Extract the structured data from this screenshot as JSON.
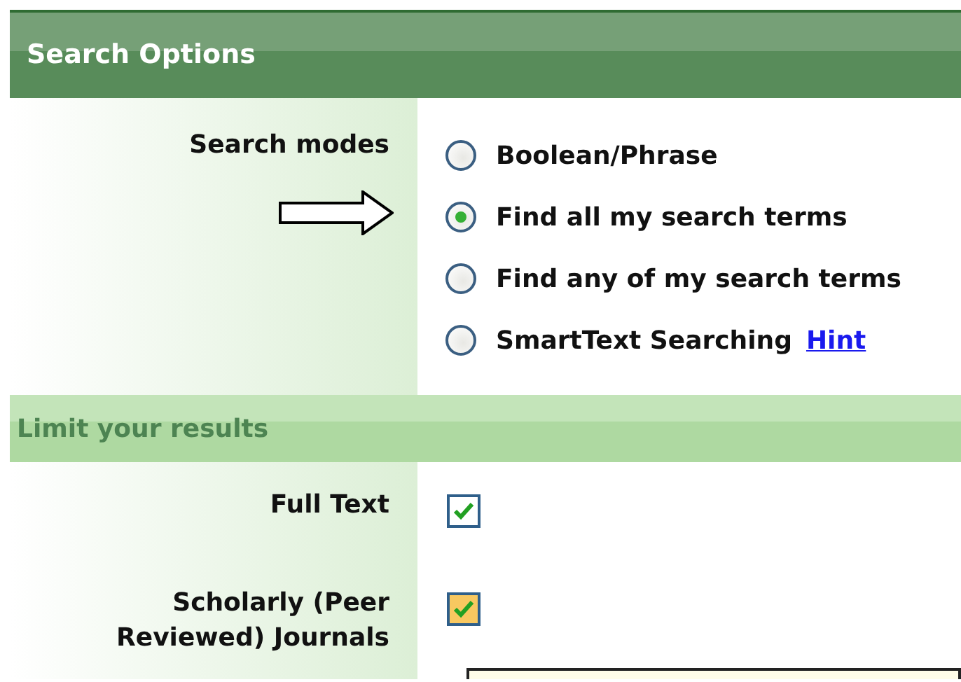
{
  "search_options": {
    "title": "Search Options",
    "search_modes": {
      "label": "Search modes",
      "options": [
        {
          "label": "Boolean/Phrase",
          "selected": false
        },
        {
          "label": "Find all my search terms",
          "selected": true
        },
        {
          "label": "Find any of my search terms",
          "selected": false
        },
        {
          "label": "SmartText Searching",
          "selected": false,
          "link": "Hint"
        }
      ]
    }
  },
  "limit_results": {
    "title": "Limit your results",
    "rows": [
      {
        "label": "Full Text",
        "checked": true,
        "color": "#ffffff"
      },
      {
        "label": "Scholarly (Peer Reviewed) Journals",
        "checked": true,
        "color": "#f8c860"
      }
    ]
  }
}
